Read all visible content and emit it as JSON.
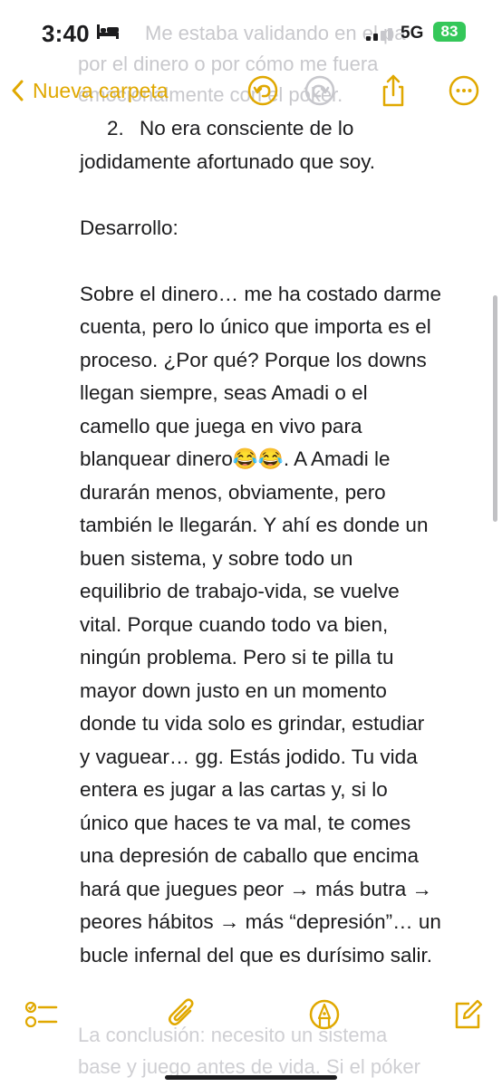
{
  "status_bar": {
    "time": "3:40",
    "network": "5G",
    "battery": "83"
  },
  "overlap_ghost": {
    "line1": "Me estaba validando en el pa",
    "line2": "por el dinero o por cómo me fuera",
    "line3": "emocionalmente con el póker."
  },
  "toolbar": {
    "back_label": "Nueva carpeta"
  },
  "note": {
    "list_number": "2.",
    "list_text_line1": "No era consciente de lo",
    "list_text_line2": "jodidamente afortunado que soy.",
    "heading": "Desarrollo:",
    "paragraph_lines": [
      "Sobre el dinero… me ha costado darme",
      "cuenta, pero lo único que importa es el",
      "proceso. ¿Por qué? Porque los downs",
      "llegan siempre, seas Amadi o el",
      "camello que juega en vivo para",
      "blanquear dinero😂😂. A Amadi le",
      "durarán menos, obviamente, pero",
      "también le llegarán. Y ahí es donde un",
      "buen sistema, y sobre todo un",
      "equilibrio de trabajo-vida, se vuelve",
      "vital. Porque cuando todo va bien,",
      "ningún problema. Pero si te pilla tu",
      "mayor down justo en un momento",
      "donde tu vida solo es grindar, estudiar",
      "y vaguear… gg. Estás jodido. Tu vida",
      "entera es jugar a las cartas y, si lo",
      "único que haces te va mal, te comes",
      "una depresión de caballo que encima",
      "hará que juegues peor → más butra →",
      "peores hábitos → más “depresión”… un",
      "bucle infernal del que es durísimo salir."
    ]
  },
  "below_ghost": {
    "line1": "La conclusión: necesito un sistema",
    "line2": "base y juego antes de vida. Si el póker"
  },
  "colors": {
    "accent": "#e0a800",
    "battery": "#34c759"
  }
}
